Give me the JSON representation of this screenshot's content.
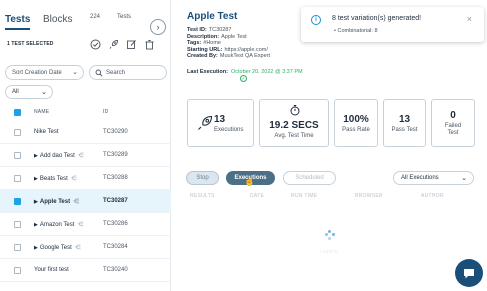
{
  "left_panel": {
    "tabs": [
      "Tests",
      "Blocks"
    ],
    "count": "224",
    "count_label": "Tests",
    "selection_text": "1 TEST SELECTED",
    "sort": {
      "value": "Sort Creation Date"
    },
    "search": {
      "placeholder": "Search"
    },
    "filter": {
      "value": "All"
    },
    "columns": [
      "NAME",
      "ID"
    ],
    "rows": [
      {
        "name": "Nike Test",
        "id": "TC30290",
        "expandable": false,
        "tree": false,
        "selected": false
      },
      {
        "name": "Add dao Test",
        "id": "TC30289",
        "expandable": true,
        "tree": true,
        "selected": false
      },
      {
        "name": "Beats Test",
        "id": "TC30288",
        "expandable": true,
        "tree": true,
        "selected": false
      },
      {
        "name": "Apple Test",
        "id": "TC30287",
        "expandable": true,
        "tree": true,
        "selected": true
      },
      {
        "name": "Amazon Test",
        "id": "TC30286",
        "expandable": true,
        "tree": true,
        "selected": false
      },
      {
        "name": "Google Test",
        "id": "TC30284",
        "expandable": true,
        "tree": true,
        "selected": false
      },
      {
        "name": "Your first test",
        "id": "TC30240",
        "expandable": false,
        "tree": false,
        "selected": false
      }
    ]
  },
  "detail": {
    "title": "Apple Test",
    "meta": [
      {
        "label": "Test ID:",
        "value": "TC30287"
      },
      {
        "label": "Description:",
        "value": "Apple Test"
      },
      {
        "label": "Tags:",
        "value": "#Home"
      },
      {
        "label": "Starting URL:",
        "value": "https://apple.com/"
      },
      {
        "label": "Created By:",
        "value": "MuukTest QA Expert"
      }
    ],
    "last_execution_label": "Last Execution:",
    "last_execution_date": "October 20, 2022 @ 3:37 PM",
    "stats": [
      {
        "value": "13",
        "label": "Executions",
        "icon": "rocket-icon"
      },
      {
        "value": "19.2 SECS",
        "label": "Avg. Test Time",
        "icon": "stopwatch-icon"
      },
      {
        "value": "100%",
        "label": "Pass Rate",
        "icon": ""
      },
      {
        "value": "13",
        "label": "Pass Test",
        "icon": ""
      },
      {
        "value": "0",
        "label": "Failed Test",
        "icon": ""
      }
    ],
    "buttons": {
      "stop": "Stop",
      "executions": "Executions",
      "scheduled": "Scheduled"
    },
    "executions_filter": {
      "value": "All Executions"
    },
    "table_headers": [
      "RESULTS",
      "DATE",
      "RUN TIME",
      "BROWSER",
      "AUTHOR"
    ],
    "loading_text": "Loading"
  },
  "toast": {
    "message": "8 test variation(s) generated!",
    "detail": "Combinatorial: 8"
  },
  "colors": {
    "accent": "#1a4f7a",
    "selected_row": "#e6f4fb",
    "success": "#2eaf6a",
    "info": "#1a8fd6"
  }
}
